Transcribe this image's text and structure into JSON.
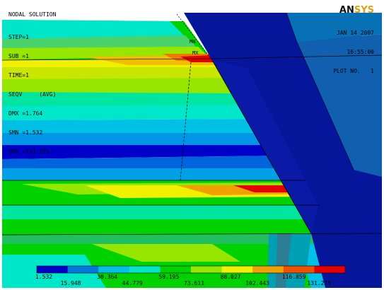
{
  "title": "NODAL SOLUTION",
  "info": {
    "step": "STEP=1",
    "sub": "SUB =1",
    "time": "TIME=1",
    "seqv": "SEQV     (AVG)",
    "dmx": "DMX =1.764",
    "smn": "SMN =1.532",
    "smx": "SMX =131.275"
  },
  "logo": {
    "part1": "AN",
    "part2": "SYS"
  },
  "date": "JAN 14 2007",
  "time_stamp": "16:55:00",
  "plot_no": "PLOT NO.   1",
  "node_markers": {
    "mn": "MN",
    "mx": "MX"
  },
  "legend": {
    "colors": [
      "#0000c8",
      "#0078dc",
      "#00c0e6",
      "#00e6c8",
      "#00d200",
      "#96e600",
      "#f0f000",
      "#f0a000",
      "#f05000",
      "#e60000"
    ],
    "top_values": [
      "1.532",
      "30.364",
      "59.195",
      "88.027",
      "116.859"
    ],
    "bottom_values": [
      "15.948",
      "44.779",
      "73.611",
      "102.443",
      "131.275"
    ]
  }
}
